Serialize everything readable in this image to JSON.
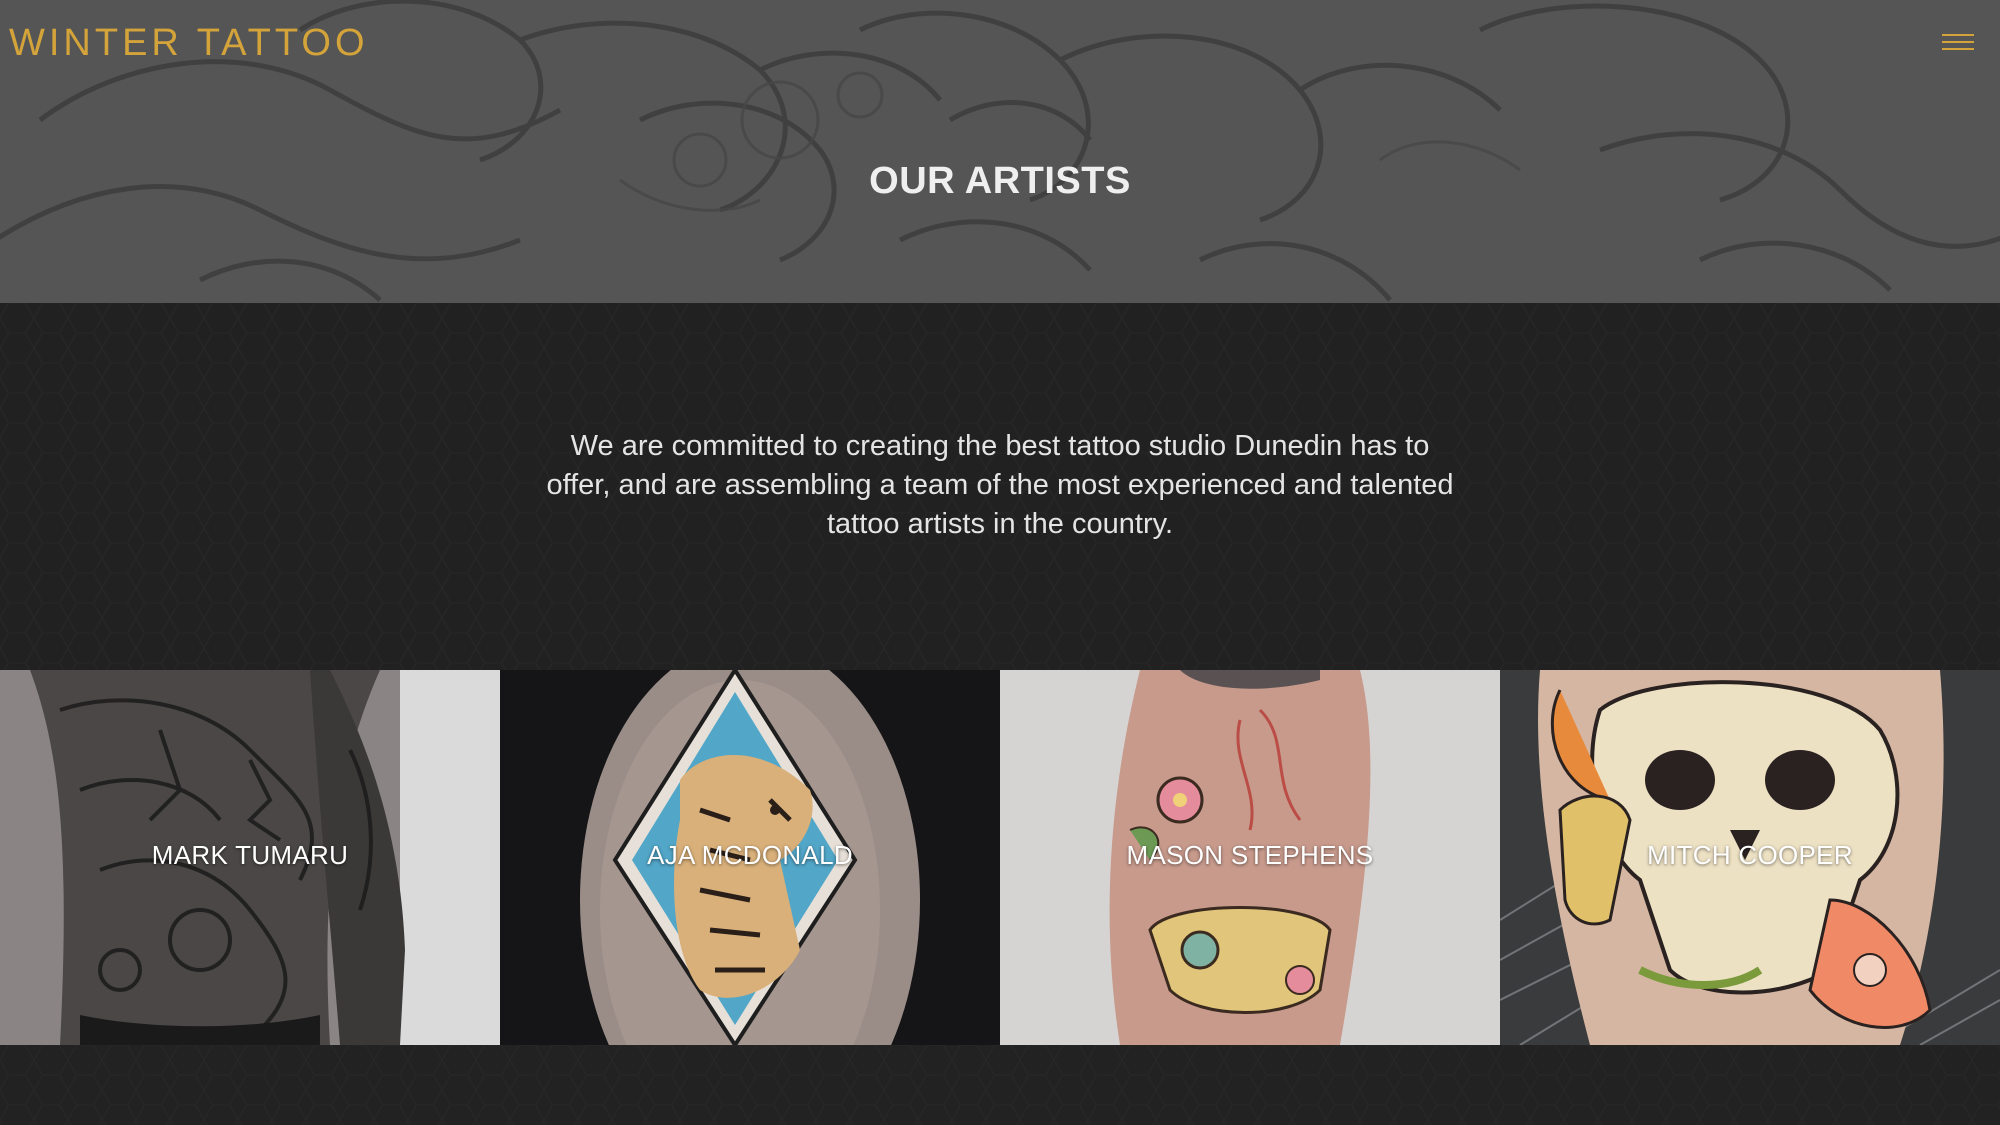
{
  "header": {
    "logo_text": "WINTER TATTOO",
    "menu_icon": "hamburger-menu-icon"
  },
  "hero": {
    "title": "OUR ARTISTS"
  },
  "intro": {
    "text": "We are committed to creating the best tattoo studio Dunedin has to offer, and are assembling a team of the most experienced and talented tattoo artists in the country."
  },
  "artists": [
    {
      "name": "MARK TUMARU"
    },
    {
      "name": "AJA MCDONALD"
    },
    {
      "name": "MASON STEPHENS"
    },
    {
      "name": "MITCH COOPER"
    }
  ],
  "colors": {
    "accent": "#d4a43a",
    "hero_bg": "#545454",
    "page_bg": "#222222",
    "title_text": "#efefef"
  }
}
